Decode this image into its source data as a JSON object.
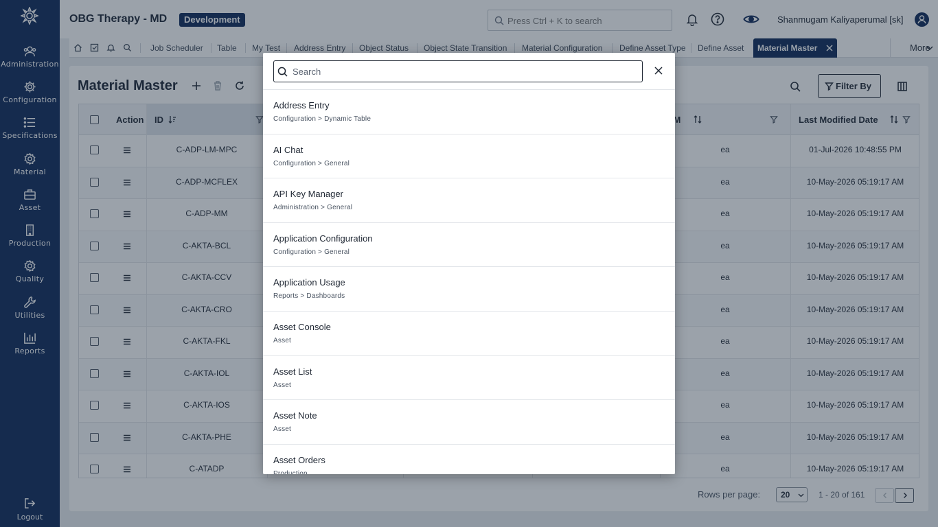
{
  "header": {
    "app_title": "OBG Therapy - MD",
    "env_badge": "Development",
    "search_placeholder": "Press Ctrl + K to search",
    "user_name": "Shanmugam Kaliyaperumal [sk]"
  },
  "sidebar": {
    "items": [
      {
        "label": "Administration",
        "icon": "users-icon"
      },
      {
        "label": "Configuration",
        "icon": "gear-icon"
      },
      {
        "label": "Specifications",
        "icon": "list-icon"
      },
      {
        "label": "Material",
        "icon": "cog-icon"
      },
      {
        "label": "Asset",
        "icon": "briefcase-icon"
      },
      {
        "label": "Production",
        "icon": "building-icon"
      },
      {
        "label": "Quality",
        "icon": "settings-icon"
      },
      {
        "label": "Utilities",
        "icon": "wrench-icon"
      },
      {
        "label": "Reports",
        "icon": "bar-chart-icon"
      }
    ],
    "logout": "Logout"
  },
  "tabs": {
    "items": [
      "Job Scheduler",
      "Table",
      "My Test",
      "Address Entry",
      "Object Status",
      "Object State Transition",
      "Material Configuration",
      "Define Asset Type",
      "Define Asset"
    ],
    "active": "Material Master",
    "more": "More"
  },
  "page": {
    "title": "Material Master",
    "filter_label": "Filter By"
  },
  "table": {
    "columns": {
      "action": "Action",
      "id": "ID",
      "uom": "UOM",
      "modified": "Last Modified Date"
    },
    "rows": [
      {
        "id": "C-ADP-LM-MPC",
        "uom": "ea",
        "modified": "01-Jul-2026 10:48:55 PM"
      },
      {
        "id": "C-ADP-MCFLEX",
        "uom": "ea",
        "modified": "10-May-2026 05:19:17 AM"
      },
      {
        "id": "C-ADP-MM",
        "uom": "ea",
        "modified": "10-May-2026 05:19:17 AM"
      },
      {
        "id": "C-AKTA-BCL",
        "uom": "ea",
        "modified": "10-May-2026 05:19:17 AM"
      },
      {
        "id": "C-AKTA-CCV",
        "uom": "ea",
        "modified": "10-May-2026 05:19:17 AM"
      },
      {
        "id": "C-AKTA-CRO",
        "uom": "ea",
        "modified": "10-May-2026 05:19:17 AM"
      },
      {
        "id": "C-AKTA-FKL",
        "uom": "ea",
        "modified": "10-May-2026 05:19:17 AM"
      },
      {
        "id": "C-AKTA-IOL",
        "uom": "ea",
        "modified": "10-May-2026 05:19:17 AM"
      },
      {
        "id": "C-AKTA-IOS",
        "uom": "ea",
        "modified": "10-May-2026 05:19:17 AM"
      },
      {
        "id": "C-AKTA-PHE",
        "uom": "ea",
        "modified": "10-May-2026 05:19:17 AM"
      },
      {
        "id": "C-ATADP",
        "uom": "ea",
        "modified": "10-May-2026 05:19:17 AM"
      }
    ]
  },
  "pager": {
    "rows_label": "Rows per page:",
    "rows_value": "20",
    "range": "1 - 20 of 161"
  },
  "modal": {
    "search_placeholder": "Search",
    "results": [
      {
        "title": "Address Entry",
        "path": "Configuration > Dynamic Table"
      },
      {
        "title": "AI Chat",
        "path": "Configuration > General"
      },
      {
        "title": "API Key Manager",
        "path": "Administration > General"
      },
      {
        "title": "Application Configuration",
        "path": "Configuration > General"
      },
      {
        "title": "Application Usage",
        "path": "Reports > Dashboards"
      },
      {
        "title": "Asset Console",
        "path": "Asset"
      },
      {
        "title": "Asset List",
        "path": "Asset"
      },
      {
        "title": "Asset Note",
        "path": "Asset"
      },
      {
        "title": "Asset Orders",
        "path": "Production"
      }
    ]
  }
}
